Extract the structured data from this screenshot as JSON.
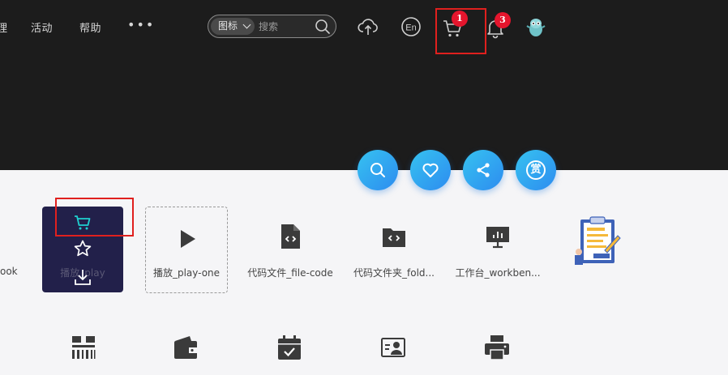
{
  "header": {
    "nav": [
      {
        "label": "理"
      },
      {
        "label": "活动"
      },
      {
        "label": "帮助"
      }
    ],
    "more_label": "•••",
    "search": {
      "type_label": "图标",
      "placeholder": "搜索"
    },
    "cart_badge": "1",
    "notification_badge": "3"
  },
  "actions": {
    "reward_label": "赏"
  },
  "grid": {
    "edge_label": "ook",
    "hover_card_label": "播放_play",
    "items": [
      {
        "label": "播放_play-one",
        "icon": "play-icon"
      },
      {
        "label": "代码文件_file-code",
        "icon": "file-code-icon"
      },
      {
        "label": "代码文件夹_fold...",
        "icon": "folder-code-icon"
      },
      {
        "label": "工作台_workben...",
        "icon": "workbench-icon"
      },
      {
        "label": "",
        "icon": "clipboard-illustration"
      }
    ],
    "row2_icons": [
      "barcode-icon",
      "wallet-icon",
      "calendar-check-icon",
      "id-card-icon",
      "printer-icon"
    ]
  },
  "colors": {
    "header_bg": "#1c1c1c",
    "accent": "#2d8cf0",
    "badge": "#e5152d",
    "hover_card_bg": "#22204a",
    "highlight": "#e0201e"
  }
}
